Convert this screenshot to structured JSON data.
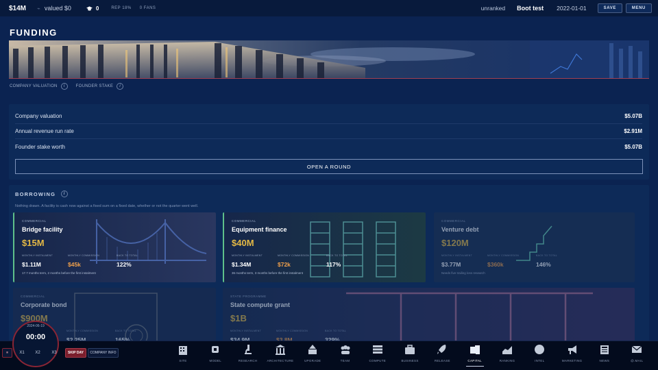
{
  "topbar": {
    "cash": "$14M",
    "valued": "valued $0",
    "capacity_count": "0",
    "rep": "REP 18%",
    "fans": "0 FANS",
    "rank": "unranked",
    "company_name": "Boot test",
    "date": "2022-01-01",
    "save_label": "SAVE",
    "menu_label": "MENU"
  },
  "page": {
    "title": "FUNDING",
    "banner_links": [
      "COMPANY VALUATION",
      "FOUNDER STAKE"
    ]
  },
  "summary": {
    "rows": [
      {
        "label": "Company valuation",
        "value": "$5.07B"
      },
      {
        "label": "Annual revenue run rate",
        "value": "$2.91M"
      },
      {
        "label": "Founder stake worth",
        "value": "$5.07B"
      }
    ],
    "round_button": "OPEN A ROUND"
  },
  "borrowing": {
    "title": "BORROWING",
    "description": "Nothing drawn. A facility is cash now against a fixed sum on a fixed date, whether or not the quarter went well.",
    "facilities": [
      {
        "tag": "COMMERCIAL",
        "name": "Bridge facility",
        "amount": "$15M",
        "l1": "MONTHLY INSTALMENT",
        "v1": "$1.11M",
        "l2": "MONTHLY COMMISSION",
        "v2": "$45k",
        "l3": "BACK TO TOTAL",
        "v3": "122%",
        "note": "17.7 months term, 2 months before the first instalment"
      },
      {
        "tag": "COMMERCIAL",
        "name": "Equipment finance",
        "amount": "$40M",
        "l1": "MONTHLY INSTALMENT",
        "v1": "$1.34M",
        "l2": "MONTHLY COMMISSION",
        "v2": "$72k",
        "l3": "BACK TO TOTAL",
        "v3": "117%",
        "note": "36 months term, 3 months before the first instalment"
      },
      {
        "tag": "COMMERCIAL",
        "name": "Venture debt",
        "amount": "$120M",
        "l1": "MONTHLY INSTALMENT",
        "v1": "$3.77M",
        "l2": "MONTHLY COMMISSION",
        "v2": "$360k",
        "l3": "BACK TO TOTAL",
        "v3": "146%",
        "note": "Needs five trailing loss research"
      },
      {
        "tag": "COMMERCIAL",
        "name": "Corporate bond",
        "amount": "$900M",
        "l1": "MONTHLY INSTALMENT",
        "v1": "$2.25M",
        "l2": "MONTHLY COMMISSION",
        "v2": "",
        "l3": "BACK TO TOTAL",
        "v3": "165%",
        "note": ""
      },
      {
        "tag": "STATE PROGRAMME",
        "name": "State compute grant",
        "amount": "$1B",
        "l1": "MONTHLY INSTALMENT",
        "v1": "$34.9M",
        "l2": "MONTHLY COMMISSION",
        "v2": "$3.8M",
        "l3": "BACK TO TOTAL",
        "v3": "329%",
        "note": ""
      }
    ]
  },
  "clock": {
    "date": "2024-06-19",
    "time": "00:00"
  },
  "controls": {
    "x1": "X1",
    "x2": "X2",
    "x3": "X3",
    "skip": "SKIP DAY",
    "company_info": "COMPANY INFO"
  },
  "nav": [
    {
      "label": "SITE",
      "icon": "building-icon"
    },
    {
      "label": "MODEL",
      "icon": "chip-icon"
    },
    {
      "label": "RESEARCH",
      "icon": "microscope-icon"
    },
    {
      "label": "ARCHITECTURE",
      "icon": "columns-icon"
    },
    {
      "label": "UPGRADE",
      "icon": "upgrade-icon"
    },
    {
      "label": "TEAM",
      "icon": "team-icon"
    },
    {
      "label": "COMPUTE",
      "icon": "server-icon"
    },
    {
      "label": "BUSINESS",
      "icon": "briefcase-icon"
    },
    {
      "label": "RELEASE",
      "icon": "rocket-icon"
    },
    {
      "label": "CAPITAL",
      "icon": "capital-icon"
    },
    {
      "label": "RANKING",
      "icon": "chart-icon"
    },
    {
      "label": "INTEL",
      "icon": "globe-icon"
    },
    {
      "label": "MARKETING",
      "icon": "megaphone-icon"
    },
    {
      "label": "NEWS",
      "icon": "newspaper-icon"
    },
    {
      "label": "@.MAIL",
      "icon": "mail-icon"
    }
  ],
  "active_nav": "CAPITAL",
  "colors": {
    "accent_gold": "#e3b845",
    "accent_orange": "#f0a04b",
    "alert_red": "#8a2535",
    "bg": "#0b2351"
  }
}
